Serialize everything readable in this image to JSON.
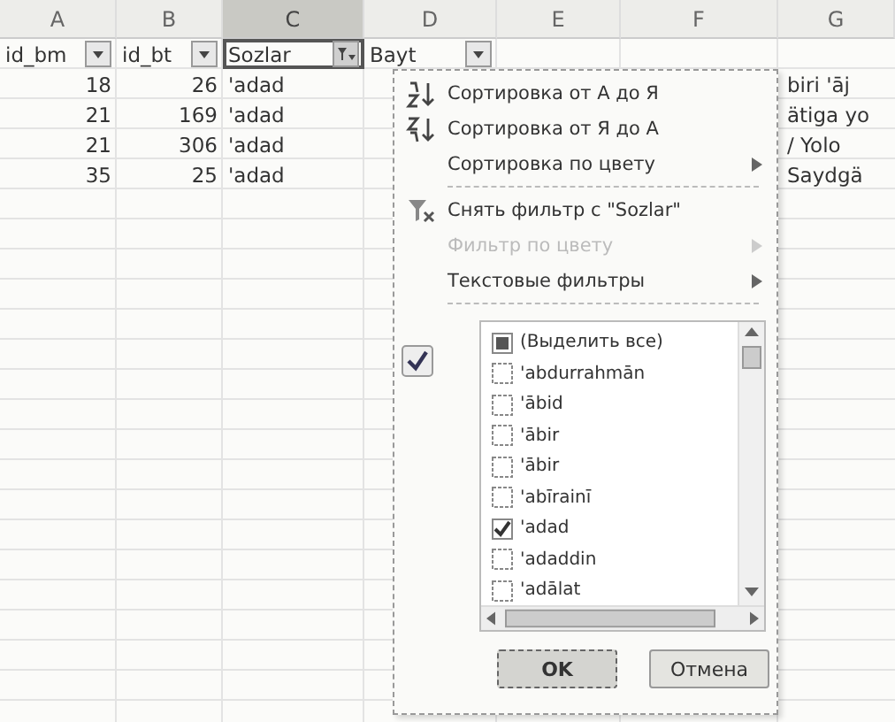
{
  "column_headers": [
    {
      "label": "A",
      "selected": false
    },
    {
      "label": "B",
      "selected": false
    },
    {
      "label": "C",
      "selected": true
    },
    {
      "label": "D",
      "selected": false
    },
    {
      "label": "E",
      "selected": false
    },
    {
      "label": "F",
      "selected": false
    },
    {
      "label": "G",
      "selected": false
    }
  ],
  "header_row": [
    {
      "label": "id_bm",
      "filtered": false
    },
    {
      "label": "id_bt",
      "filtered": false
    },
    {
      "label": "Sozlar",
      "filtered": true
    },
    {
      "label": "Bayt",
      "filtered": false
    }
  ],
  "rows": [
    {
      "cells": [
        "18",
        "26",
        "'adad"
      ],
      "column_7": "biri 'āj"
    },
    {
      "cells": [
        "21",
        "169",
        "'adad"
      ],
      "column_7": "ätiga yo"
    },
    {
      "cells": [
        "21",
        "306",
        "'adad"
      ],
      "column_7": "/ Yolo"
    },
    {
      "cells": [
        "35",
        "25",
        "'adad"
      ],
      "column_7": "Saydgä"
    }
  ],
  "filter_menu": {
    "items": [
      {
        "kind": "sort-asc",
        "label": "Сортировка от А до Я",
        "disabled": false
      },
      {
        "kind": "sort-desc",
        "label": "Сортировка от Я до А",
        "disabled": false
      },
      {
        "kind": "submenu",
        "label": "Сортировка по цвету",
        "disabled": false
      },
      {
        "kind": "separator"
      },
      {
        "kind": "clear",
        "label": "Снять фильтр с \"Sozlar\"",
        "disabled": false
      },
      {
        "kind": "submenu",
        "label": "Фильтр по цвету",
        "disabled": true
      },
      {
        "kind": "submenu",
        "label": "Текстовые фильтры",
        "disabled": false
      }
    ],
    "select_all": {
      "label": "(Выделить все)",
      "partial": true
    },
    "values": [
      {
        "label": "'abdurrahmān",
        "checked": false
      },
      {
        "label": "'ābid",
        "checked": false
      },
      {
        "label": "'ābir",
        "checked": false
      },
      {
        "label": "'ābir",
        "checked": false
      },
      {
        "label": "'abīrainī",
        "checked": false
      },
      {
        "label": "'adad",
        "checked": true
      },
      {
        "label": "'adaddin",
        "checked": false
      },
      {
        "label": "'adālat",
        "checked": false
      }
    ],
    "buttons": [
      {
        "label": "OK",
        "selected": true
      },
      {
        "label": "Отмена",
        "selected": false
      }
    ]
  }
}
